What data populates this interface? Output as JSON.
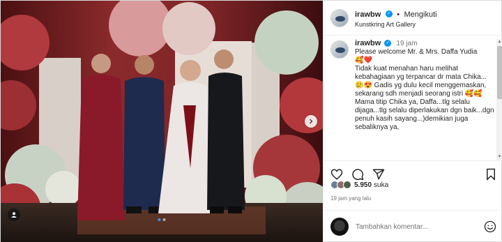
{
  "post": {
    "username": "irawbw",
    "verified_mark": "✓",
    "separator": "•",
    "follow_status": "Mengikuti",
    "location": "Kunstkring Art Gallery"
  },
  "caption": {
    "username": "irawbw",
    "time_ago": "19 jam",
    "lines": [
      "Please welcome Mr. & Mrs. Daffa Yudia",
      "🥰❤️",
      "Tidak kuat menahan haru melihat kebahagiaan yg terpancar dr mata Chika...🥲😍 Gadis yg dulu kecil menggemaskan, sekarang sdh menjadi seorang istri 🥰🥰",
      "Mama titip Chika ya, Daffa...tlg selalu dijaga...tlg selalu diperlakukan dgn baik...dgn penuh kasih sayang...)demikian juga sebaliknya ya,"
    ]
  },
  "engagement": {
    "likes_count": "5.950",
    "likes_label": "suka",
    "posted_ago": "19 jam yang lalu"
  },
  "comment": {
    "placeholder": "Tambahkan komentar..."
  },
  "icons": [
    "heart-icon",
    "comment-icon",
    "share-icon",
    "bookmark-icon",
    "emoji-icon",
    "chevron-right-icon",
    "user-tag-icon",
    "verified-badge-icon"
  ],
  "colors": {
    "accent": "#0095f6",
    "text": "#262626",
    "muted": "#737373",
    "border": "#efefef"
  },
  "carousel": {
    "total_slides": 2,
    "active_slide": 1
  }
}
